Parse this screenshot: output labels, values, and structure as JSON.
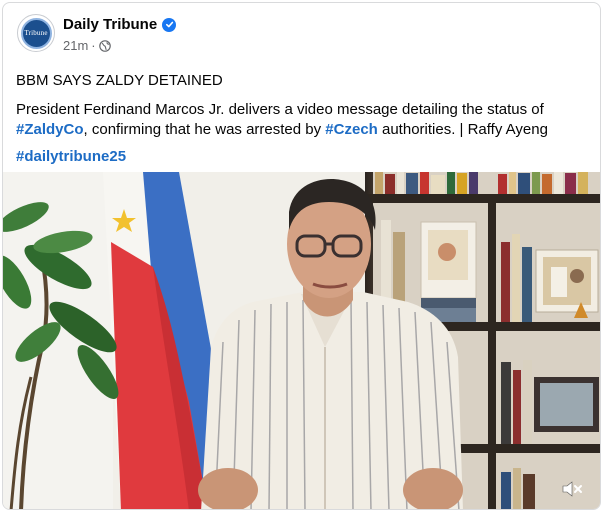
{
  "post": {
    "page_name": "Daily Tribune",
    "avatar_text": "Tribune",
    "time": "21m",
    "separator": "·",
    "headline": "BBM SAYS ZALDY DETAINED",
    "body_part1": "President Ferdinand Marcos Jr. delivers a video message detailing the status of ",
    "hashtag1": "#ZaldyCo",
    "body_part2": ", confirming that he was arrested by ",
    "hashtag2": "#Czech",
    "body_part3": " authorities. | Raffy Ayeng",
    "hashtag3": "#dailytribune25"
  },
  "colors": {
    "brand_blue": "#1877f2",
    "hashtag_blue": "#1d6cc5",
    "meta_gray": "#65676b",
    "flag_blue": "#3b6fc4",
    "flag_red": "#e03a3e",
    "flag_sun": "#f2c12e"
  },
  "icons": {
    "verified": "verified-badge-icon",
    "audience": "globe-icon",
    "mute": "speaker-muted-icon"
  },
  "media": {
    "type": "video",
    "muted": true
  }
}
